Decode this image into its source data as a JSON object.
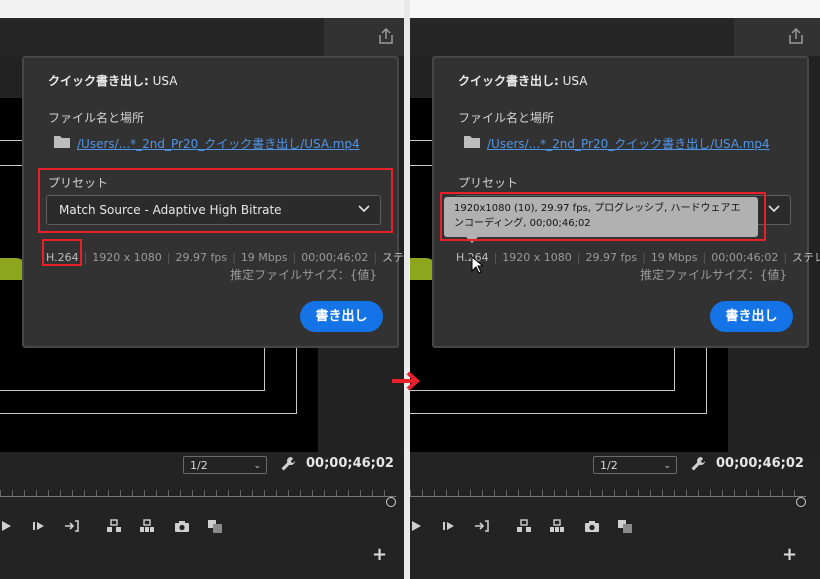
{
  "left": {
    "dialog": {
      "title_bold": "クイック書き出し:",
      "title_name": "USA",
      "file_label": "ファイル名と場所",
      "file_path": "/Users/...*_2nd_Pr20_クイック書き出し/USA.mp4",
      "preset_label": "プリセット",
      "preset_value": "Match Source - Adaptive High Bitrate",
      "info": {
        "codec": "H.264",
        "resolution": "1920 x 1080",
        "fps": "29.97 fps",
        "bitrate": "19 Mbps",
        "duration": "00;00;46;02",
        "audio": "ステレオ"
      },
      "estimated_size": "推定ファイルサイズ：{値}",
      "export_button": "書き出し"
    },
    "monitor": {
      "resolution": "1/2",
      "timecode": "00;00;46;02"
    }
  },
  "right": {
    "dialog": {
      "title_bold": "クイック書き出し:",
      "title_name": "USA",
      "file_label": "ファイル名と場所",
      "file_path": "/Users/...*_2nd_Pr20_クイック書き出し/USA.mp4",
      "preset_label": "プリセット",
      "tooltip": "1920x1080 (10), 29.97 fps, プログレッシブ, ハードウェアエンコーディング, 00;00;46;02",
      "info": {
        "codec": "H.264",
        "resolution": "1920 x 1080",
        "fps": "29.97 fps",
        "bitrate": "19 Mbps",
        "duration": "00;00;46;02",
        "audio": "ステレオ"
      },
      "estimated_size": "推定ファイルサイズ：{値}",
      "export_button": "書き出し"
    },
    "monitor": {
      "resolution": "1/2",
      "timecode": "00;00;46;02"
    }
  },
  "colors": {
    "highlight": "#e8202a",
    "accent": "#1473e6",
    "link": "#4f95e6"
  },
  "icons": [
    "share-icon",
    "folder-icon",
    "chevron-down-icon",
    "wrench-icon",
    "play-icon",
    "step-forward-icon",
    "go-to-out-icon",
    "lift-icon",
    "extract-icon",
    "camera-icon",
    "compare-icon",
    "add-icon",
    "cursor-icon",
    "arrow-right-icon"
  ]
}
